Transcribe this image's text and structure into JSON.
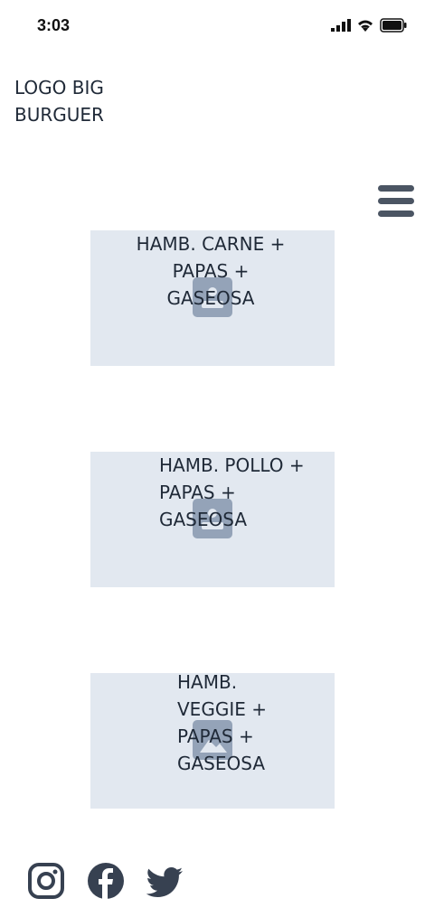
{
  "status_bar": {
    "time": "3:03"
  },
  "logo": {
    "line1": "LOGO BIG",
    "line2": "BURGUER"
  },
  "menu": {
    "icon": "hamburger-menu-icon"
  },
  "products": [
    {
      "title": "HAMB. CARNE + PAPAS + GASEOSA",
      "icon": "image-placeholder-icon"
    },
    {
      "title": "HAMB. POLLO + PAPAS + GASEOSA",
      "icon": "image-placeholder-icon"
    },
    {
      "title": "HAMB. VEGGIE + PAPAS + GASEOSA",
      "icon": "image-placeholder-icon"
    }
  ],
  "socials": [
    "instagram-icon",
    "facebook-icon",
    "twitter-icon"
  ],
  "colors": {
    "card_bg": "#e2e8f0",
    "icon": "#4b5563",
    "placeholder": "#94a3b8"
  }
}
